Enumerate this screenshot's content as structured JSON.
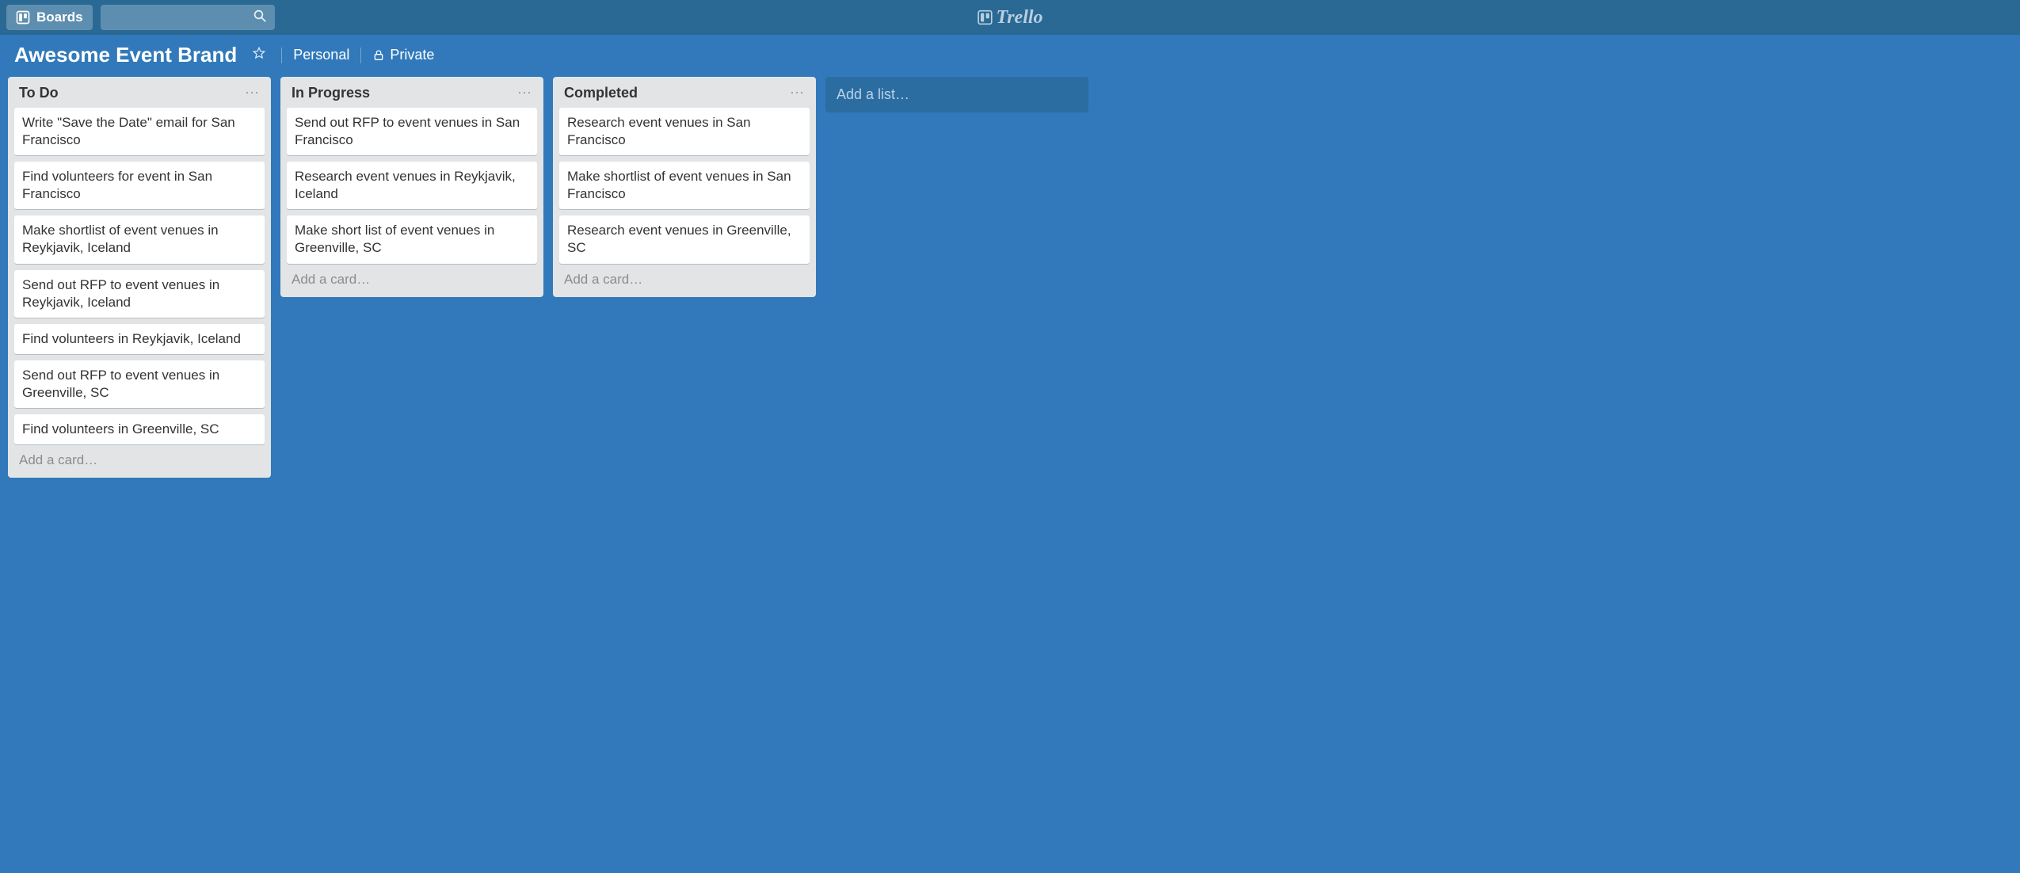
{
  "header": {
    "boards_label": "Boards",
    "logo_text": "Trello",
    "search_placeholder": ""
  },
  "board": {
    "title": "Awesome Event Brand",
    "personal_label": "Personal",
    "private_label": "Private"
  },
  "lists": [
    {
      "title": "To Do",
      "cards": [
        "Write \"Save the Date\" email for San Francisco",
        "Find volunteers for event in San Francisco",
        "Make shortlist of event venues in Reykjavik, Iceland",
        "Send out RFP to event venues in Reykjavik, Iceland",
        "Find volunteers in Reykjavik, Iceland",
        "Send out RFP to event venues in Greenville, SC",
        "Find volunteers in Greenville, SC"
      ]
    },
    {
      "title": "In Progress",
      "cards": [
        "Send out RFP to event venues in San Francisco",
        "Research event venues in Reykjavik, Iceland",
        "Make short list of event venues in Greenville, SC"
      ]
    },
    {
      "title": "Completed",
      "cards": [
        "Research event venues in San Francisco",
        "Make shortlist of event venues in San Francisco",
        "Research event venues in Greenville, SC"
      ]
    }
  ],
  "ui": {
    "add_card_label": "Add a card…",
    "add_list_label": "Add a list…"
  }
}
